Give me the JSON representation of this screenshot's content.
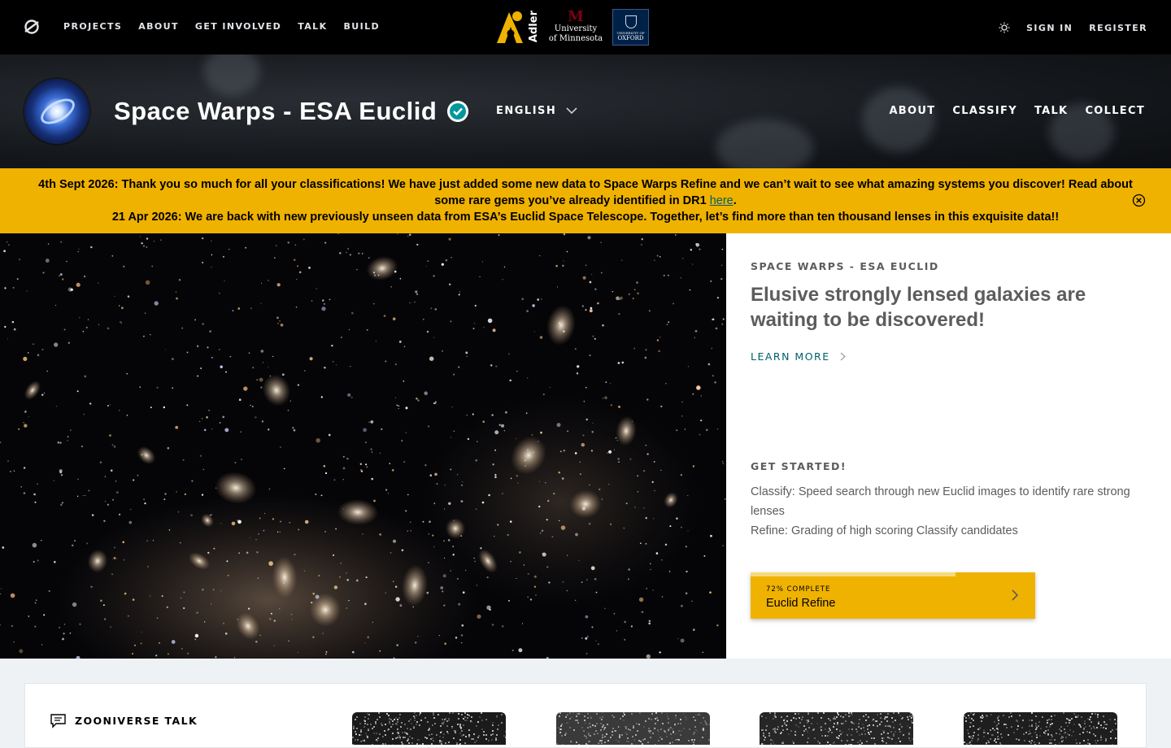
{
  "topbar": {
    "nav": [
      "PROJECTS",
      "ABOUT",
      "GET INVOLVED",
      "TALK",
      "BUILD"
    ],
    "partners": {
      "adler": "Adler",
      "umn_line1": "University",
      "umn_line2": "of Minnesota",
      "oxford_small": "UNIVERSITY OF",
      "oxford": "OXFORD"
    },
    "sign_in": "SIGN IN",
    "register": "REGISTER"
  },
  "project": {
    "title": "Space Warps - ESA Euclid",
    "language": "ENGLISH",
    "nav": [
      "ABOUT",
      "CLASSIFY",
      "TALK",
      "COLLECT"
    ]
  },
  "announcement": {
    "line1_text": "4th Sept 2026: Thank you so much for all your classifications! We have just added some new data to Space Warps Refine and we can’t wait to see what amazing systems you discover! Read about some rare gems you’ve already identified in DR1 ",
    "line1_link": "here",
    "line1_end": ".",
    "line2": "21 Apr 2026: We are back with new previously unseen data from ESA’s Euclid Space Telescope. Together, let’s find more than ten thousand lenses in this exquisite data!!"
  },
  "info": {
    "kicker": "SPACE WARPS - ESA EUCLID",
    "headline": "Elusive strongly lensed galaxies are waiting to be discovered!",
    "learn_more": "LEARN MORE",
    "get_started": "GET STARTED!",
    "desc_line1": "Classify: Speed search through new Euclid images to identify rare strong lenses",
    "desc_line2": "Refine: Grading of high scoring Classify candidates",
    "workflow": {
      "progress_label": "72% COMPLETE",
      "progress": 0.72,
      "name": "Euclid Refine"
    }
  },
  "talk": {
    "title": "ZOONIVERSE TALK"
  },
  "colors": {
    "accent": "#f0b200",
    "link": "#005f6b",
    "text": "#5c5c5c"
  }
}
